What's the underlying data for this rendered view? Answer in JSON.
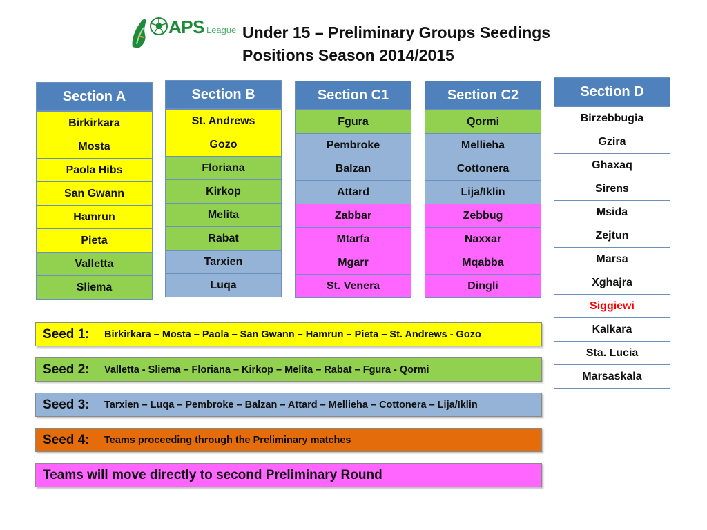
{
  "header": {
    "logo": {
      "brand": "APS",
      "suffix": "League",
      "icon": "football-boot-ball-icon"
    },
    "title_line1": "Under 15 – Preliminary Groups Seedings",
    "title_line2": "Positions Season 2014/2015"
  },
  "colors": {
    "header_blue": "#4f81bd",
    "seed1_yellow": "#ffff00",
    "seed2_green": "#92d050",
    "seed3_blue": "#95b3d7",
    "seed4_orange": "#e46c0a",
    "direct_pink": "#ff66ff",
    "highlight_red": "#ff0000"
  },
  "sections": [
    {
      "title": "Section A",
      "teams": [
        {
          "name": "Birkirkara",
          "seed": 1
        },
        {
          "name": "Mosta",
          "seed": 1
        },
        {
          "name": "Paola Hibs",
          "seed": 1
        },
        {
          "name": "San Gwann",
          "seed": 1
        },
        {
          "name": "Hamrun",
          "seed": 1
        },
        {
          "name": "Pieta",
          "seed": 1
        },
        {
          "name": "Valletta",
          "seed": 2
        },
        {
          "name": "Sliema",
          "seed": 2
        }
      ]
    },
    {
      "title": "Section B",
      "teams": [
        {
          "name": "St. Andrews",
          "seed": 1
        },
        {
          "name": "Gozo",
          "seed": 1
        },
        {
          "name": "Floriana",
          "seed": 2
        },
        {
          "name": "Kirkop",
          "seed": 2
        },
        {
          "name": "Melita",
          "seed": 2
        },
        {
          "name": "Rabat",
          "seed": 2
        },
        {
          "name": "Tarxien",
          "seed": 3
        },
        {
          "name": "Luqa",
          "seed": 3
        }
      ]
    },
    {
      "title": "Section C1",
      "teams": [
        {
          "name": "Fgura",
          "seed": 2
        },
        {
          "name": "Pembroke",
          "seed": 3
        },
        {
          "name": "Balzan",
          "seed": 3
        },
        {
          "name": "Attard",
          "seed": 3
        },
        {
          "name": "Zabbar",
          "seed": "direct"
        },
        {
          "name": "Mtarfa",
          "seed": "direct"
        },
        {
          "name": "Mgarr",
          "seed": "direct"
        },
        {
          "name": "St. Venera",
          "seed": "direct"
        }
      ]
    },
    {
      "title": "Section C2",
      "teams": [
        {
          "name": "Qormi",
          "seed": 2
        },
        {
          "name": "Mellieha",
          "seed": 3
        },
        {
          "name": "Cottonera",
          "seed": 3
        },
        {
          "name": "Lija/Iklin",
          "seed": 3
        },
        {
          "name": "Zebbug",
          "seed": "direct"
        },
        {
          "name": "Naxxar",
          "seed": "direct"
        },
        {
          "name": "Mqabba",
          "seed": "direct"
        },
        {
          "name": "Dingli",
          "seed": "direct"
        }
      ]
    },
    {
      "title": "Section D",
      "teams": [
        {
          "name": "Birzebbugia",
          "seed": "none"
        },
        {
          "name": "Gzira",
          "seed": "none"
        },
        {
          "name": "Ghaxaq",
          "seed": "none"
        },
        {
          "name": "Sirens",
          "seed": "none"
        },
        {
          "name": "Msida",
          "seed": "none"
        },
        {
          "name": "Zejtun",
          "seed": "none"
        },
        {
          "name": "Marsa",
          "seed": "none"
        },
        {
          "name": "Xghajra",
          "seed": "none"
        },
        {
          "name": "Siggiewi",
          "seed": "none",
          "highlight": "red"
        },
        {
          "name": "Kalkara",
          "seed": "none"
        },
        {
          "name": "Sta. Lucia",
          "seed": "none"
        },
        {
          "name": "Marsaskala",
          "seed": "none"
        }
      ]
    }
  ],
  "legend": [
    {
      "label": "Seed 1:",
      "text": "Birkirkara – Mosta – Paola  – San Gwann – Hamrun – Pieta – St. Andrews - Gozo",
      "color": "#ffff00"
    },
    {
      "label": "Seed 2:",
      "text": "Valletta - Sliema – Floriana – Kirkop – Melita – Rabat – Fgura - Qormi",
      "color": "#92d050"
    },
    {
      "label": "Seed 3:",
      "text": "Tarxien – Luqa – Pembroke – Balzan – Attard – Mellieha – Cottonera – Lija/Iklin",
      "color": "#95b3d7"
    },
    {
      "label": "Seed 4:",
      "text": "Teams proceeding through the Preliminary  matches",
      "color": "#e46c0a"
    },
    {
      "label": "",
      "text": "Teams will move directly to second Preliminary Round",
      "color": "#ff66ff"
    }
  ]
}
